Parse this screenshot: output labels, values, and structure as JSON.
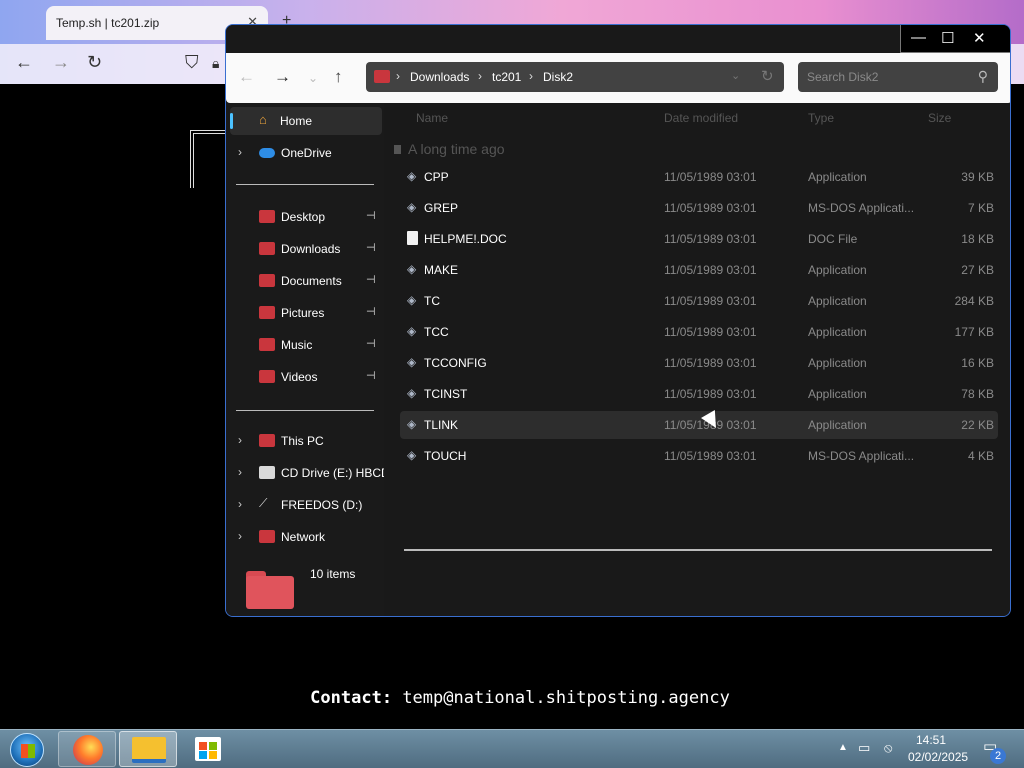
{
  "browser": {
    "tab_title": "Temp.sh | tc201.zip",
    "tab_close": "✕",
    "new_tab": "+"
  },
  "contact": {
    "label": "Contact:",
    "email": "temp@national.shitposting.agency"
  },
  "explorer": {
    "window_buttons": {
      "minimize": "—",
      "maximize": "☐",
      "close": "✕"
    },
    "breadcrumb": [
      "Downloads",
      "tc201",
      "Disk2"
    ],
    "search_placeholder": "Search Disk2",
    "sidebar": {
      "home": "Home",
      "onedrive": "OneDrive",
      "quick_access": [
        {
          "label": "Desktop",
          "icon": "desktop-icon"
        },
        {
          "label": "Downloads",
          "icon": "downloads-icon"
        },
        {
          "label": "Documents",
          "icon": "documents-icon"
        },
        {
          "label": "Pictures",
          "icon": "pictures-icon"
        },
        {
          "label": "Music",
          "icon": "music-icon"
        },
        {
          "label": "Videos",
          "icon": "videos-icon"
        }
      ],
      "drives": [
        {
          "label": "This PC",
          "icon": "pc-icon"
        },
        {
          "label": "CD Drive (E:) HBCD",
          "icon": "cd-drive-icon"
        },
        {
          "label": "FREEDOS (D:)",
          "icon": "usb-drive-icon"
        },
        {
          "label": "Network",
          "icon": "network-icon"
        }
      ]
    },
    "columns": {
      "name": "Name",
      "date": "Date modified",
      "type": "Type",
      "size": "Size"
    },
    "group_header": "A long time ago",
    "files": [
      {
        "name": "CPP",
        "date": "11/05/1989 03:01",
        "type": "Application",
        "size": "39 KB",
        "icon": "app"
      },
      {
        "name": "GREP",
        "date": "11/05/1989 03:01",
        "type": "MS-DOS Applicati...",
        "size": "7 KB",
        "icon": "app"
      },
      {
        "name": "HELPME!.DOC",
        "date": "11/05/1989 03:01",
        "type": "DOC File",
        "size": "18 KB",
        "icon": "doc"
      },
      {
        "name": "MAKE",
        "date": "11/05/1989 03:01",
        "type": "Application",
        "size": "27 KB",
        "icon": "app"
      },
      {
        "name": "TC",
        "date": "11/05/1989 03:01",
        "type": "Application",
        "size": "284 KB",
        "icon": "app"
      },
      {
        "name": "TCC",
        "date": "11/05/1989 03:01",
        "type": "Application",
        "size": "177 KB",
        "icon": "app"
      },
      {
        "name": "TCCONFIG",
        "date": "11/05/1989 03:01",
        "type": "Application",
        "size": "16 KB",
        "icon": "app"
      },
      {
        "name": "TCINST",
        "date": "11/05/1989 03:01",
        "type": "Application",
        "size": "78 KB",
        "icon": "app"
      },
      {
        "name": "TLINK",
        "date": "11/05/1989 03:01",
        "type": "Application",
        "size": "22 KB",
        "icon": "app",
        "selected": true
      },
      {
        "name": "TOUCH",
        "date": "11/05/1989 03:01",
        "type": "MS-DOS Applicati...",
        "size": "4 KB",
        "icon": "app"
      }
    ],
    "item_count": "10 items"
  },
  "taskbar": {
    "time": "14:51",
    "date": "02/02/2025",
    "notifications": "2"
  }
}
